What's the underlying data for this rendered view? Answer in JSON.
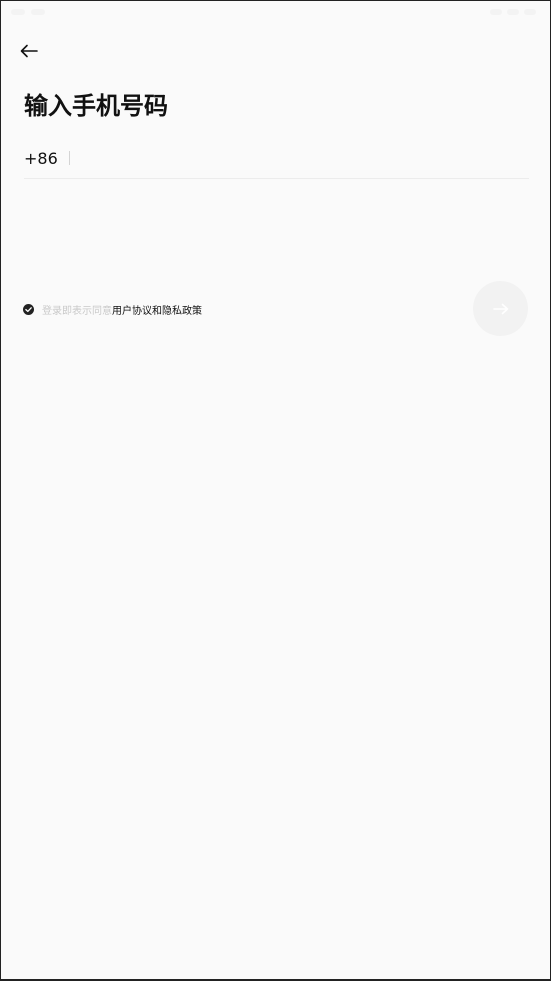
{
  "header": {
    "back_icon": "arrow-left-icon"
  },
  "page": {
    "title": "输入手机号码"
  },
  "phone": {
    "country_code": "+86",
    "value": "",
    "placeholder": ""
  },
  "agreement": {
    "checked": true,
    "check_icon": "check-circle-icon",
    "prefix": "登录即表示同意",
    "link": "用户协议和隐私政策"
  },
  "next": {
    "icon": "arrow-right-icon",
    "enabled": false
  },
  "colors": {
    "background": "#fafafa",
    "text": "#111111",
    "muted_text": "#c9c9c9",
    "next_button_bg": "#f2f2f2"
  }
}
